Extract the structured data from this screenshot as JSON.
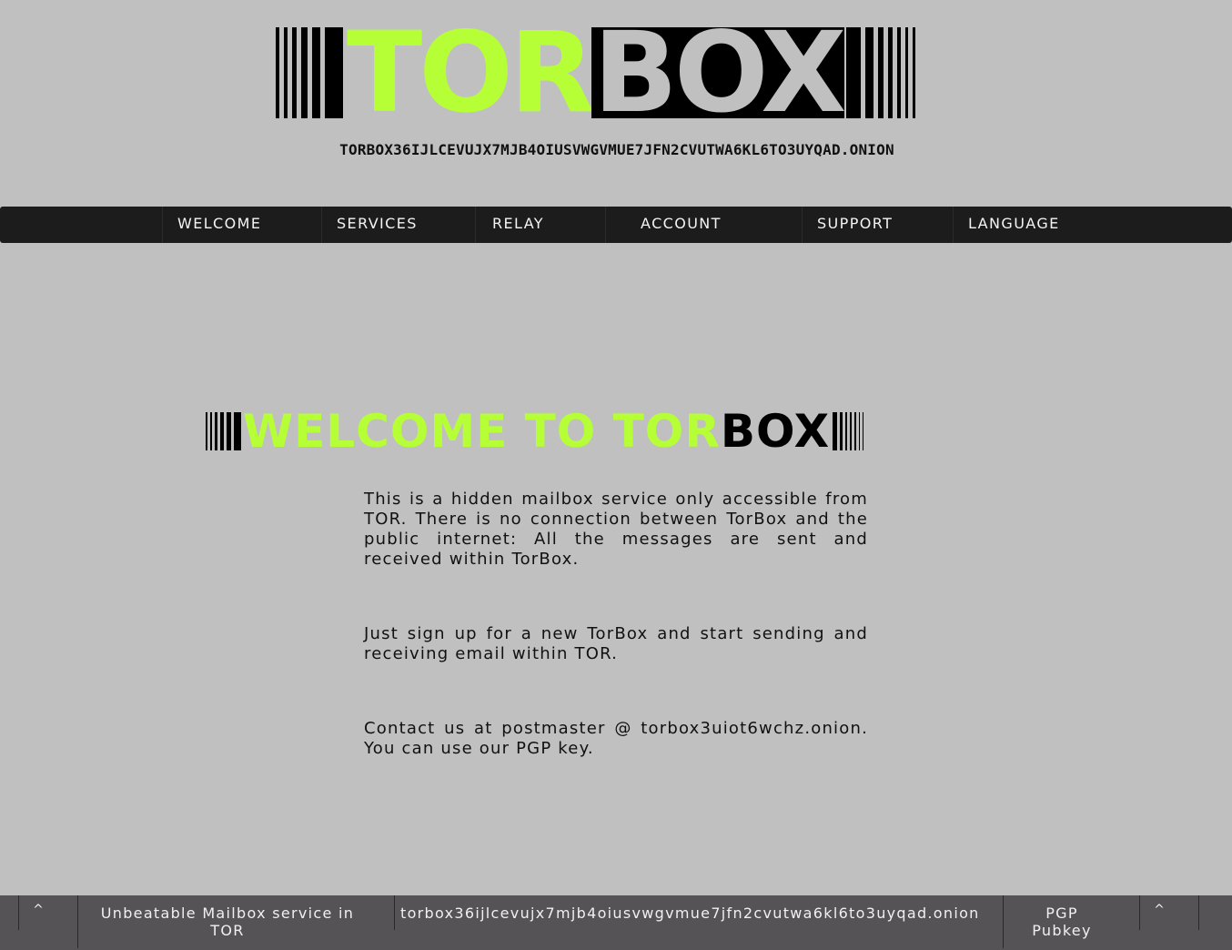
{
  "header": {
    "logo_tor": "TOR",
    "logo_box": "BOX",
    "onion_address": "TORBOX36IJLCEVUJX7MJB4OIUSVWGVMUE7JFN2CVUTWA6KL6TO3UYQAD.ONION"
  },
  "nav": {
    "items": [
      {
        "label": "WELCOME"
      },
      {
        "label": "SERVICES"
      },
      {
        "label": "RELAY"
      },
      {
        "label": "ACCOUNT"
      },
      {
        "label": "SUPPORT"
      },
      {
        "label": "LANGUAGE"
      }
    ]
  },
  "main": {
    "heading_green": "WELCOME TO TOR",
    "heading_black": "BOX",
    "paragraphs": [
      "This is a hidden mailbox service only accessible from TOR. There is no connection between TorBox and the public internet: All the messages are sent and received within TorBox.",
      "Just sign up for a new TorBox and start sending and receiving email within TOR.",
      "Contact us at postmaster @ torbox3uiot6wchz.onion. You can use our PGP key."
    ]
  },
  "footer": {
    "tagline": "Unbeatable Mailbox service in TOR",
    "onion": "torbox36ijlcevujx7mjb4oiusvwgvmue7jfn2cvutwa6kl6to3uyqad.onion",
    "pgp": "PGP Pubkey",
    "up_left": "^",
    "up_right": "^"
  },
  "colors": {
    "background": "#c0c0c0",
    "accent_green": "#b6ff37",
    "nav_bg": "#1c1c1c",
    "footer_bg": "#555355"
  }
}
